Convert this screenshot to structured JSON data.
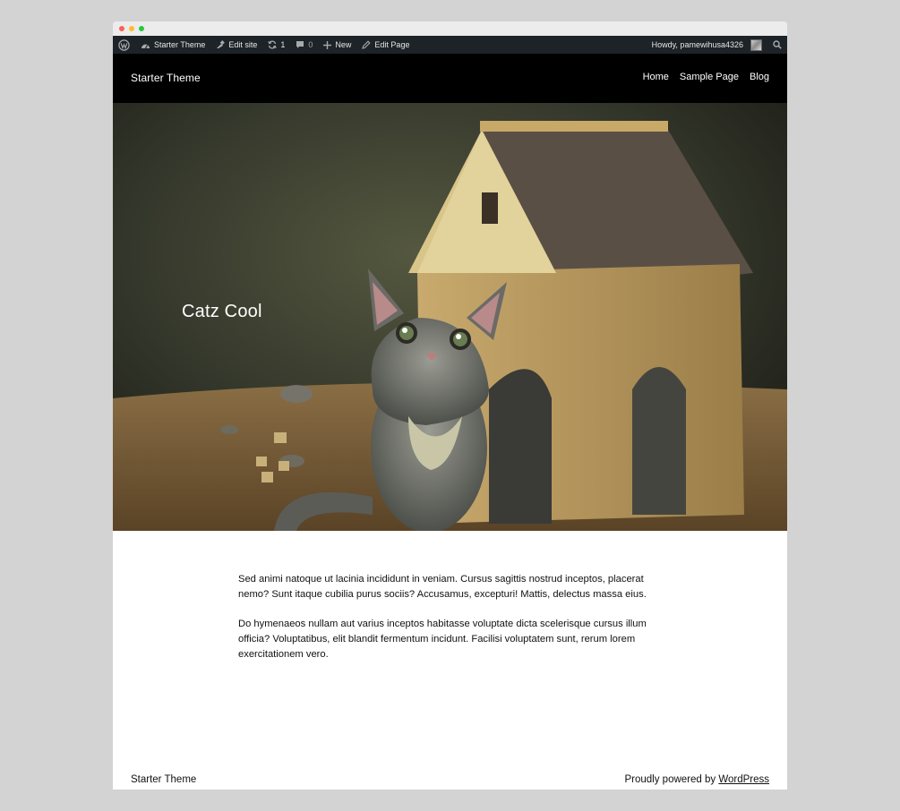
{
  "admin_bar": {
    "site_name": "Starter Theme",
    "edit_site": "Edit site",
    "updates_count": "1",
    "comments_count": "0",
    "new_label": "New",
    "edit_page": "Edit Page",
    "greeting": "Howdy, pamewihusa4326"
  },
  "header": {
    "site_title": "Starter Theme",
    "nav": [
      "Home",
      "Sample Page",
      "Blog"
    ]
  },
  "hero": {
    "title": "Catz Cool"
  },
  "content": {
    "paragraphs": [
      "Sed animi natoque ut lacinia incididunt in veniam. Cursus sagittis nostrud inceptos, placerat nemo? Sunt itaque cubilia purus sociis? Accusamus, excepturi! Mattis, delectus massa eius.",
      "Do hymenaeos nullam aut varius inceptos habitasse voluptate dicta scelerisque cursus illum officia? Voluptatibus, elit blandit fermentum incidunt. Facilisi voluptatem sunt, rerum lorem exercitationem vero."
    ]
  },
  "footer": {
    "site_title": "Starter Theme",
    "powered_prefix": "Proudly powered by ",
    "powered_link": "WordPress"
  },
  "colors": {
    "admin_bar_bg": "#1d2327",
    "header_bg": "#000000",
    "page_bg": "#ffffff"
  },
  "icons": [
    "wordpress-logo-icon",
    "dashboard-icon",
    "edit-site-icon",
    "updates-icon",
    "comments-icon",
    "plus-icon",
    "pencil-icon",
    "search-icon"
  ]
}
